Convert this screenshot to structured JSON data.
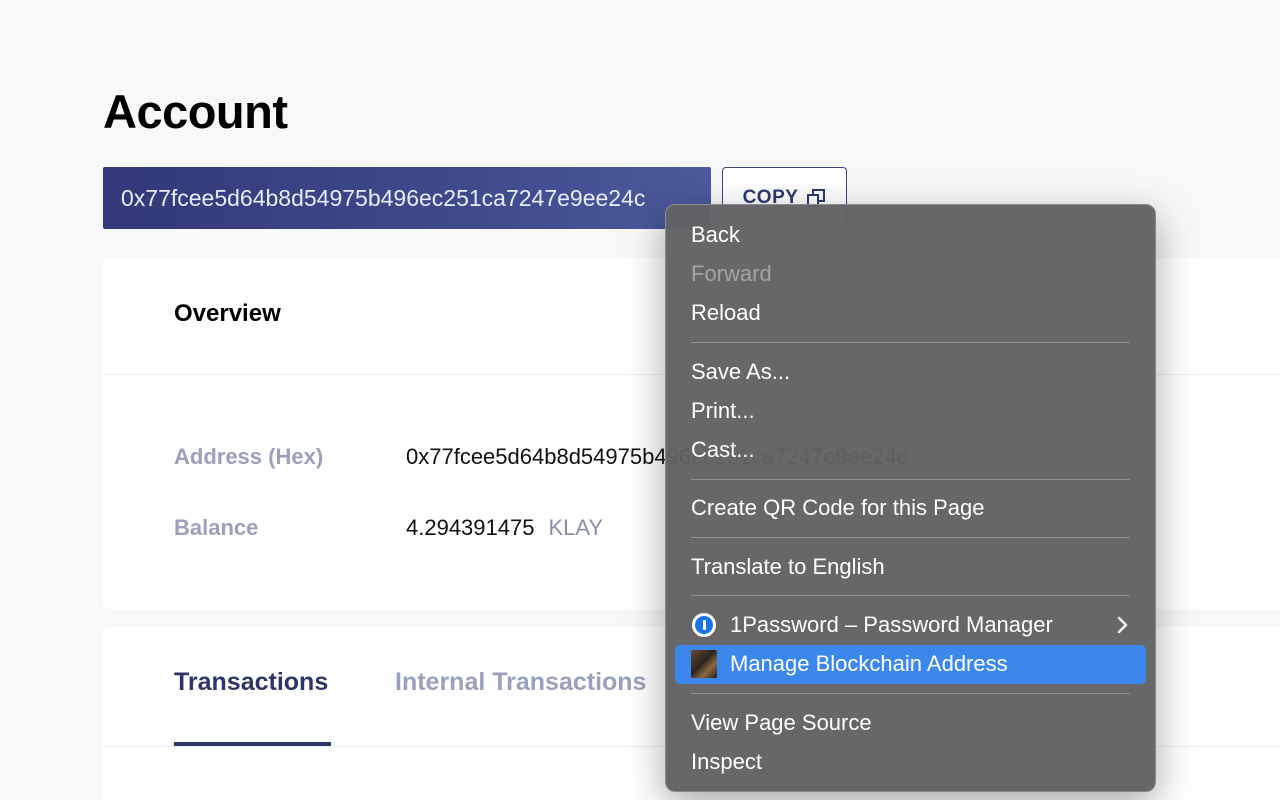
{
  "page": {
    "title": "Account",
    "address": "0x77fcee5d64b8d54975b496ec251ca7247e9ee24c",
    "copy_label": "COPY"
  },
  "overview": {
    "title": "Overview",
    "rows": [
      {
        "label": "Address (Hex)",
        "value": "0x77fcee5d64b8d54975b496ec251ca7247e9ee24c"
      },
      {
        "label": "Balance",
        "value": "4.294391475",
        "unit": "KLAY"
      }
    ]
  },
  "tabs": [
    {
      "label": "Transactions",
      "active": true
    },
    {
      "label": "Internal Transactions",
      "active": false
    }
  ],
  "context_menu": {
    "items": {
      "back": "Back",
      "forward": "Forward",
      "reload": "Reload",
      "save_as": "Save As...",
      "print": "Print...",
      "cast": "Cast...",
      "qr": "Create QR Code for this Page",
      "translate": "Translate to English",
      "onepassword": "1Password – Password Manager",
      "manage_address": "Manage Blockchain Address",
      "view_source": "View Page Source",
      "inspect": "Inspect"
    },
    "highlight_color": "#3b87ec",
    "icons": {
      "onepassword": "1password-icon",
      "manage_address": "extension-thumbnail-icon",
      "submenu": "chevron-right-icon"
    }
  },
  "colors": {
    "address_bar": "#33397a",
    "accent": "#2e3568",
    "muted_label": "#9aa0bd"
  }
}
